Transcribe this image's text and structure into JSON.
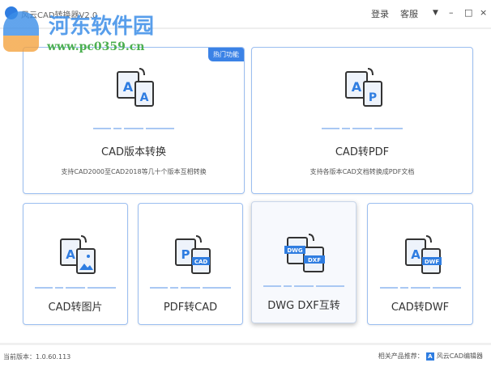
{
  "window": {
    "title": "风云CAD转换器V2.0",
    "login": "登录",
    "service": "客服",
    "menu_icon": "dropdown-icon",
    "minimize": "–",
    "maximize": "□",
    "close": "×"
  },
  "watermark": {
    "name": "河东软件园",
    "url": "www.pc0359.cn"
  },
  "cards": [
    {
      "name": "CAD版本转换",
      "desc": "支持CAD2000至CAD2018等几十个版本互相转换",
      "badge": "热门功能",
      "icon_a": "A",
      "icon_b": "A"
    },
    {
      "name": "CAD转PDF",
      "desc": "支持各版本CAD文档转换成PDF文档",
      "icon_a": "A",
      "icon_b": "P"
    },
    {
      "name": "CAD转图片",
      "icon_a": "A"
    },
    {
      "name": "PDF转CAD",
      "icon_a": "P",
      "icon_b": "CAD"
    },
    {
      "name": "DWG DXF互转",
      "icon_a": "DWG",
      "icon_b": "DXF"
    },
    {
      "name": "CAD转DWF",
      "icon_a": "A",
      "icon_b": "DWF"
    }
  ],
  "footer": {
    "version": "当前版本：1.0.60.113",
    "related_label": "相关产品推荐：",
    "related_product": "风云CAD编辑器",
    "related_icon": "A"
  },
  "colors": {
    "accent": "#3b82e6",
    "border": "#9bbef0"
  }
}
